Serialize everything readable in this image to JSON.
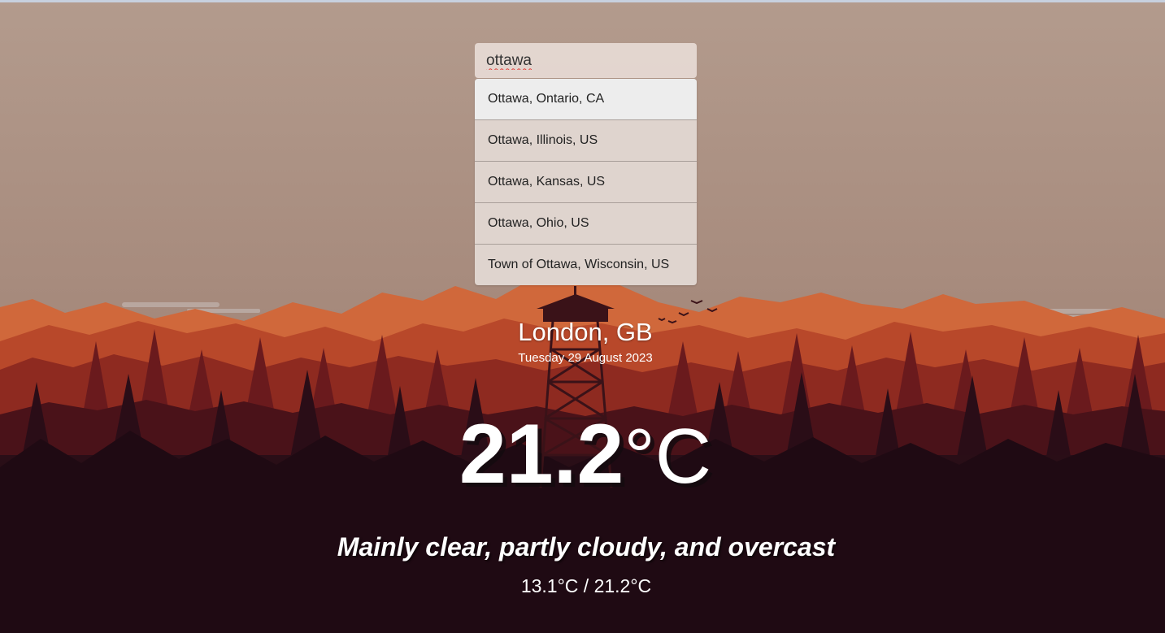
{
  "colors": {
    "sky_top": "#b49c8e",
    "sky_bottom": "#a48477",
    "mountain_far": "#d4693b",
    "forest_mid": "#7a1f1c",
    "forest_dark": "#1c0a14",
    "text": "#ffffff"
  },
  "search": {
    "value": "ottawa",
    "placeholder": ""
  },
  "suggestions": [
    {
      "label": "Ottawa, Ontario, CA"
    },
    {
      "label": "Ottawa, Illinois, US"
    },
    {
      "label": "Ottawa, Kansas, US"
    },
    {
      "label": "Ottawa, Ohio, US"
    },
    {
      "label": "Town of Ottawa, Wisconsin, US"
    }
  ],
  "weather": {
    "location": "London, GB",
    "date": "Tuesday 29 August 2023",
    "temperature": "21.2",
    "unit": "°C",
    "condition": "Mainly clear, partly cloudy, and overcast",
    "minmax": "13.1°C / 21.2°C"
  },
  "background": {
    "icon": "forest-lookout-tower-illustration"
  }
}
